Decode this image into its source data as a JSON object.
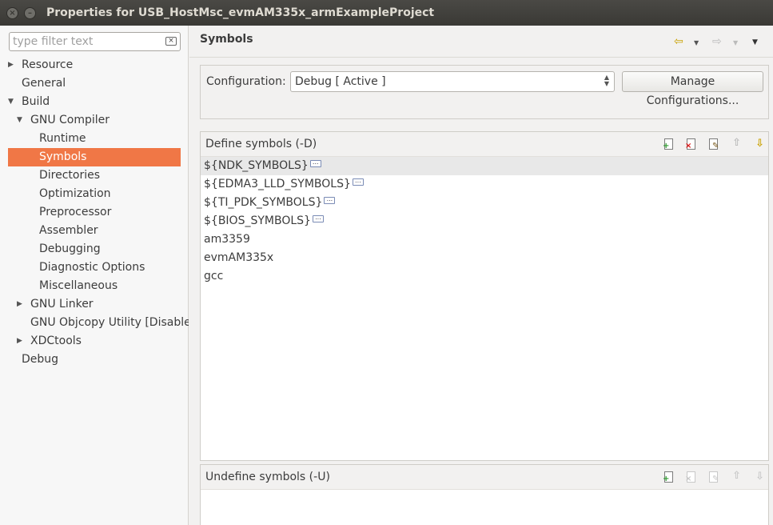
{
  "window": {
    "title": "Properties for USB_HostMsc_evmAM335x_armExampleProject",
    "close_glyph": "×",
    "min_glyph": "–"
  },
  "filter": {
    "placeholder": "type filter text",
    "clear_glyph": "×"
  },
  "tree": {
    "resource": "Resource",
    "general": "General",
    "build": "Build",
    "gnu_compiler": "GNU Compiler",
    "runtime": "Runtime",
    "symbols": "Symbols",
    "directories": "Directories",
    "optimization": "Optimization",
    "preprocessor": "Preprocessor",
    "assembler": "Assembler",
    "debugging": "Debugging",
    "diagnostic_options": "Diagnostic Options",
    "miscellaneous": "Miscellaneous",
    "gnu_linker": "GNU Linker",
    "gnu_objcopy": "GNU Objcopy Utility  [Disabled]",
    "xdctools": "XDCtools",
    "debug": "Debug",
    "arrow_collapsed": "▶",
    "arrow_expanded": "▼"
  },
  "page": {
    "title": "Symbols"
  },
  "config": {
    "label": "Configuration:",
    "value": "Debug  [ Active ]",
    "manage_button": "Manage Configurations..."
  },
  "define_panel": {
    "title": "Define symbols (-D)",
    "items": [
      {
        "text": "${NDK_SYMBOLS}",
        "has_ellipsis": true
      },
      {
        "text": "${EDMA3_LLD_SYMBOLS}",
        "has_ellipsis": true
      },
      {
        "text": "${TI_PDK_SYMBOLS}",
        "has_ellipsis": true
      },
      {
        "text": "${BIOS_SYMBOLS}",
        "has_ellipsis": true
      },
      {
        "text": "am3359",
        "has_ellipsis": false
      },
      {
        "text": "evmAM335x",
        "has_ellipsis": false
      },
      {
        "text": "gcc",
        "has_ellipsis": false
      }
    ]
  },
  "undefine_panel": {
    "title": "Undefine symbols (-U)"
  },
  "icons": {
    "back": "⇦",
    "forward": "⇨",
    "dropdown": "▼",
    "add": "+",
    "delete": "×",
    "edit": "✎",
    "move_up": "⇧",
    "move_down": "⇩",
    "ellipsis": "...",
    "updown": "▲▼"
  },
  "colors": {
    "selection": "#f07746",
    "titlebar": "#3a3935"
  }
}
